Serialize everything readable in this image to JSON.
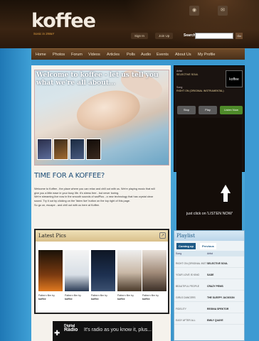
{
  "header": {
    "logo": "koffee",
    "tagline": "Sonic in 2WaY",
    "sign_in": "Sign In",
    "join_up": "Join Up",
    "search_label": "Search",
    "search_button": "Go"
  },
  "nav": {
    "items": [
      "Home",
      "Photos",
      "Forum",
      "Videos",
      "Articles",
      "Polls",
      "Audio",
      "Events",
      "About Us",
      "My Profile"
    ]
  },
  "hero": {
    "title": "Welcome to koffee - let us tell you what we're all about..."
  },
  "main": {
    "section_title": "TIME FOR A KOFFEE?",
    "intro_lines": [
      "Welcome to Koffee - the place where you can relax and chill out with us. We're playing music that will",
      "give you a little ease in your busy life. It's stress free - but never boring.",
      "We're streaming live now in the smooth sounds of sadPlus - a new technology that has crystal clear",
      "sound. Try it out by clicking on the 'listen live' button on the top right of this page.",
      "So go on, escape - and chill out with us here at Koffee."
    ]
  },
  "latest_pics": {
    "title": "Latest Pics",
    "captions": [
      [
        "Pattern film by",
        "koffee"
      ],
      [
        "Pattern film by",
        "koffee"
      ],
      [
        "Pattern film by",
        "koffee"
      ],
      [
        "Pattern film by",
        "koffee"
      ],
      [
        "Pattern film by",
        "koffee"
      ]
    ]
  },
  "radio_banner": {
    "logo_top": "Digital",
    "logo_bottom": "Radio",
    "tagline": "It's radio as you know it, plus..."
  },
  "player": {
    "artist_label": "Artist",
    "artist": "SELECTIVE SOUL",
    "song_label": "Song",
    "song": "RIGHT ON (ORIGINAL INSTRUMENTAL)",
    "buttons": [
      "Stop",
      "Play",
      "Listen Now"
    ],
    "thumb": "koffee",
    "listen_text": "just click on 'LISTEN NOW'",
    "ad_logo": "koffee",
    "ad_tagline": "Sonic in 2WaY"
  },
  "playlist": {
    "title": "Playlist",
    "tabs": [
      "Coming up",
      "Previous"
    ],
    "columns": [
      "Song",
      "Artist"
    ],
    "rows": [
      [
        "RIGHT ON (ORIGINAL INST",
        "SELECTIVE SOUL"
      ],
      [
        "YOUR LOVE IS KING",
        "SADE"
      ],
      [
        "BEAUTIFUL PEOPLE",
        "CRAZY PENIS"
      ],
      [
        "GIRLS DANCERS",
        "THE SLEEPY JACKSON"
      ],
      [
        "FIDELITY",
        "REGINA SPEKTOR"
      ],
      [
        "EASY AFTER ALL",
        "EMILY QUAYE"
      ]
    ]
  }
}
